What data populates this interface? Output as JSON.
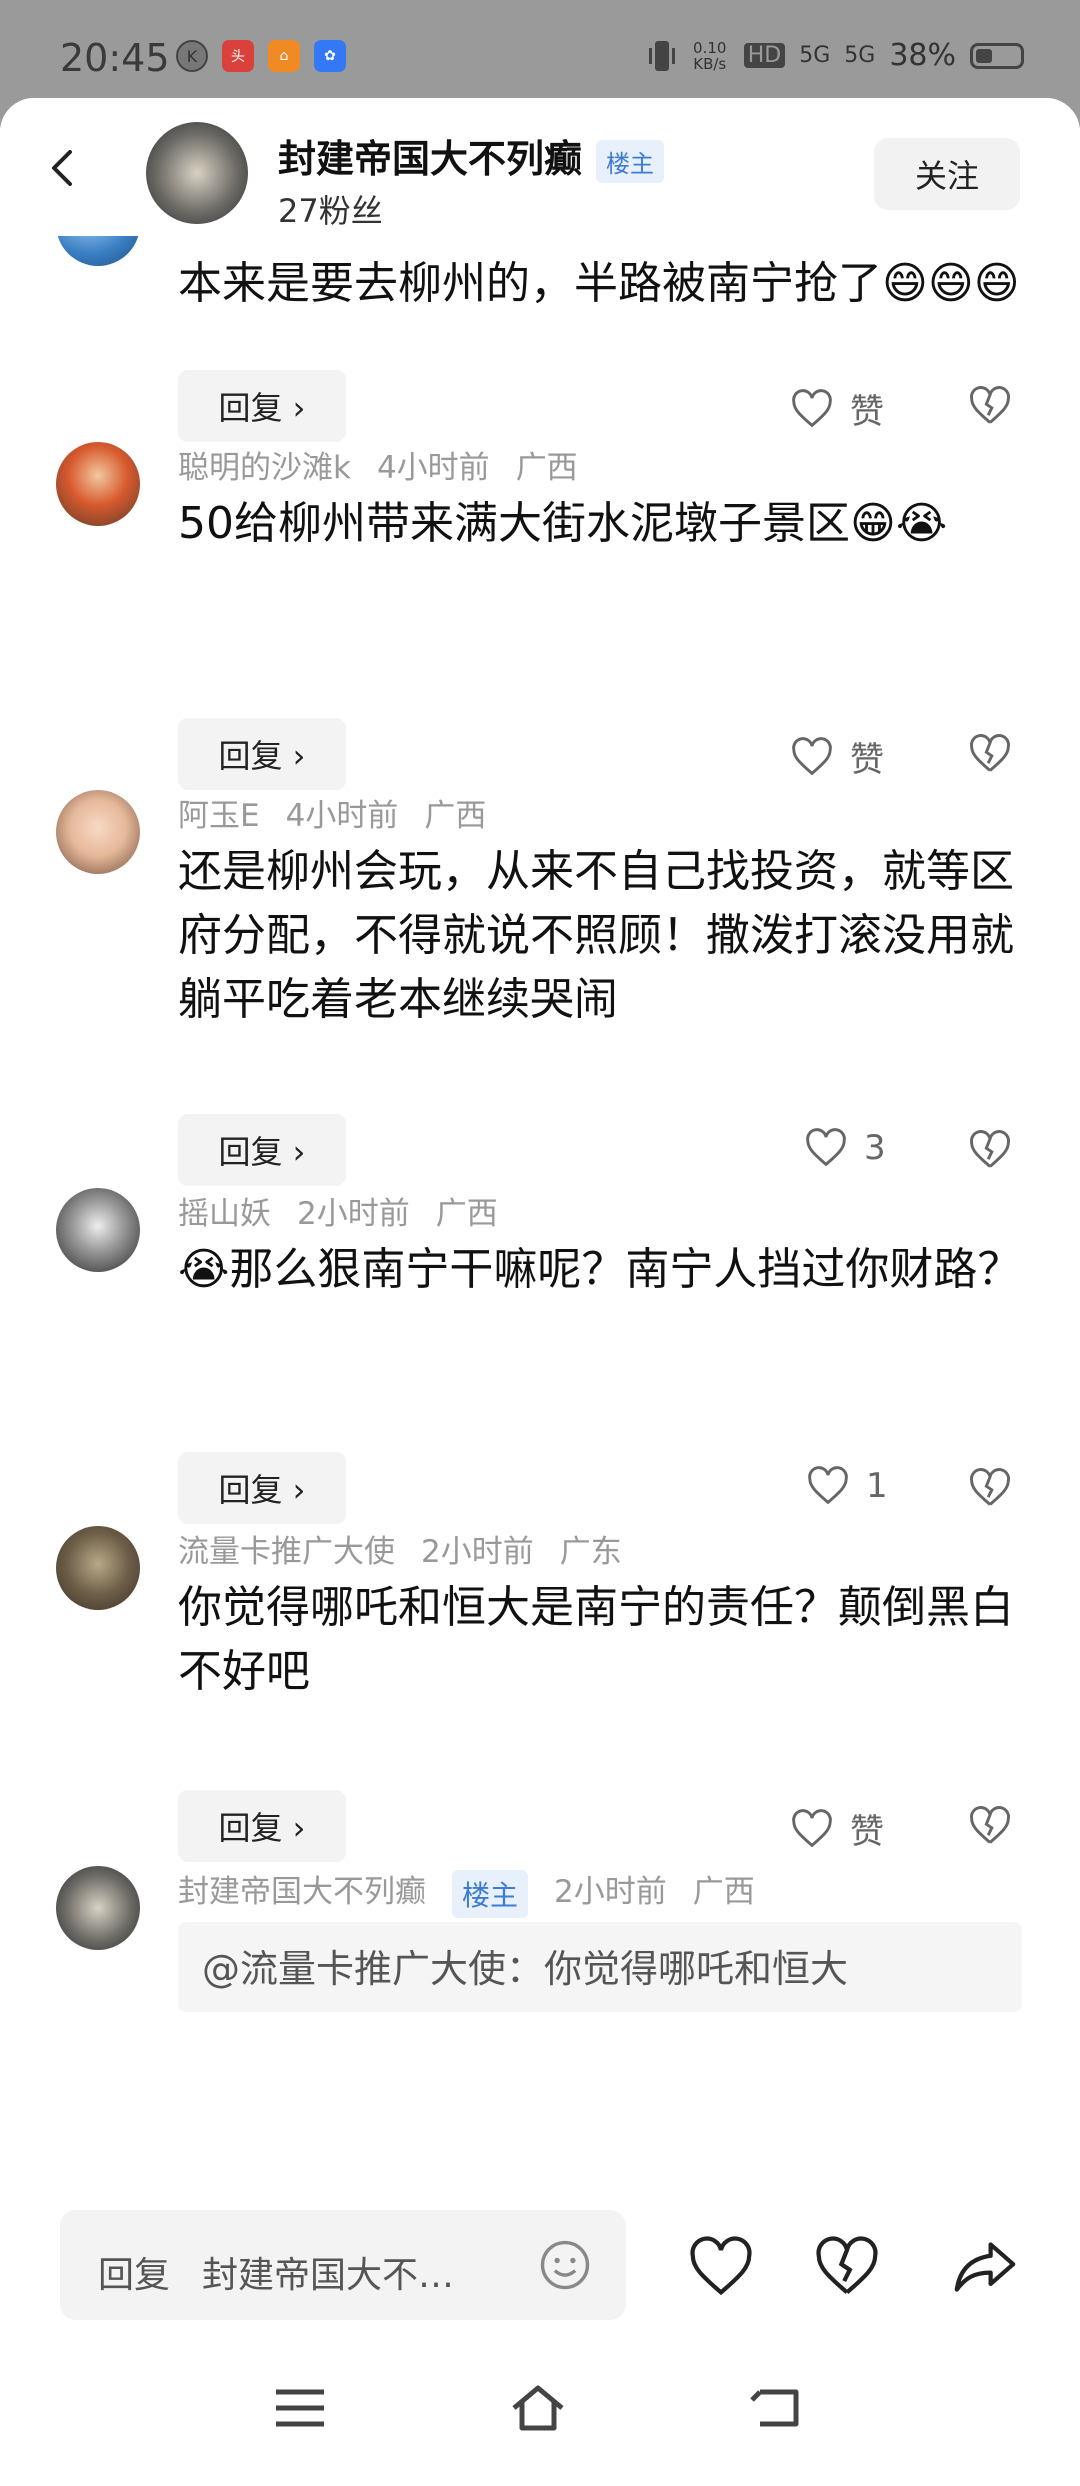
{
  "status_bar": {
    "time": "20:45",
    "net_speed": "0.10 KB/s",
    "hd": "HD",
    "signal1": "5G",
    "signal2": "5G",
    "battery_pct": "38%",
    "battery_level": 0.38
  },
  "header": {
    "username": "封建帝国大不列癫",
    "host_badge": "楼主",
    "fans": "27粉丝",
    "follow_label": "关注"
  },
  "comments": [
    {
      "text": "本来是要去柳州的，半路被南宁抢了😄😄😄",
      "reply_label": "回复 ›",
      "like_label": "赞"
    },
    {
      "author": "聪明的沙滩k",
      "time": "4小时前",
      "location": "广西",
      "text": "50给柳州带来满大街水泥墩子景区😁😭",
      "reply_label": "回复 ›",
      "like_label": "赞"
    },
    {
      "author": "阿玉E",
      "time": "4小时前",
      "location": "广西",
      "text": "还是柳州会玩，从来不自己找投资，就等区府分配，不得就说不照顾！撒泼打滚没用就躺平吃着老本继续哭闹",
      "reply_label": "回复 ›",
      "like_label": "3"
    },
    {
      "author": "摇山妖",
      "time": "2小时前",
      "location": "广西",
      "text": "😭那么狠南宁干嘛呢？南宁人挡过你财路？",
      "reply_label": "回复 ›",
      "like_label": "1"
    },
    {
      "author": "流量卡推广大使",
      "time": "2小时前",
      "location": "广东",
      "text": "你觉得哪吒和恒大是南宁的责任？颠倒黑白不好吧",
      "reply_label": "回复 ›",
      "like_label": "赞"
    },
    {
      "author": "封建帝国大不列癫",
      "badge": "楼主",
      "time": "2小时前",
      "location": "广西",
      "quote": "@流量卡推广大使：你觉得哪吒和恒大"
    }
  ],
  "bottom_bar": {
    "reply_label": "回复",
    "reply_target": "封建帝国大不…"
  },
  "colors": {
    "accent_blue": "#3d7bd6",
    "muted_text": "#999999",
    "button_bg": "#f3f3f3"
  }
}
